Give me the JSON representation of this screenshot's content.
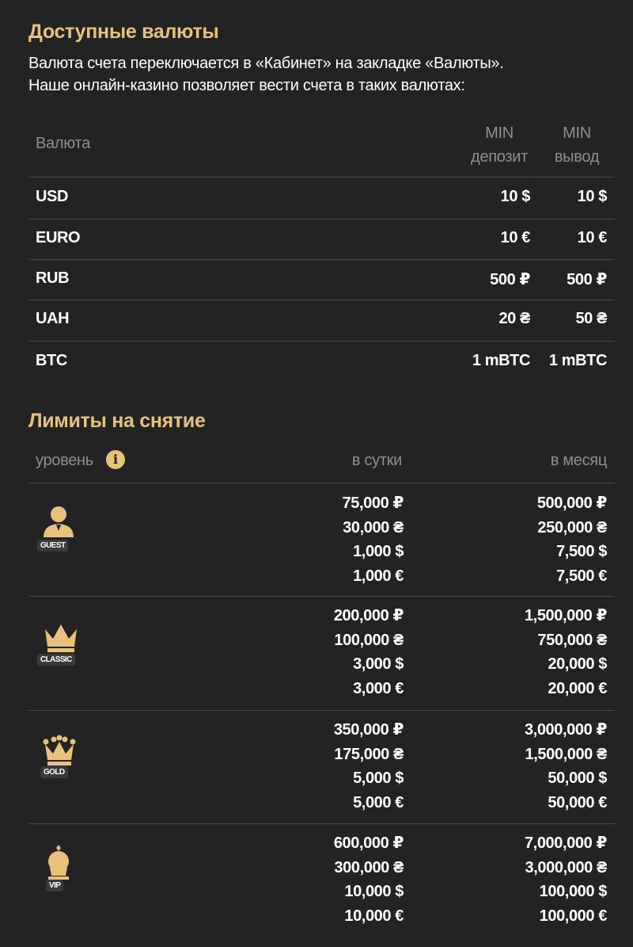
{
  "currencies_section": {
    "title": "Доступные валюты",
    "description_line1": "Валюта счета переключается в «Кабинет» на закладке «Валюты».",
    "description_line2": "Наше онлайн-казино позволяет вести счета в таких валютах:",
    "headers": {
      "currency": "Валюта",
      "min_deposit_1": "MIN",
      "min_deposit_2": "депозит",
      "min_withdraw_1": "MIN",
      "min_withdraw_2": "вывод"
    },
    "rows": [
      {
        "currency": "USD",
        "min_deposit": "10 $",
        "min_withdraw": "10 $"
      },
      {
        "currency": "EURO",
        "min_deposit": "10 €",
        "min_withdraw": "10 €"
      },
      {
        "currency": "RUB",
        "min_deposit": "500 ₽",
        "min_withdraw": "500 ₽"
      },
      {
        "currency": "UAH",
        "min_deposit": "20 ₴",
        "min_withdraw": "50 ₴"
      },
      {
        "currency": "BTC",
        "min_deposit": "1 mBTC",
        "min_withdraw": "1 mBTC"
      }
    ]
  },
  "limits_section": {
    "title": "Лимиты на снятие",
    "headers": {
      "level": "уровень",
      "per_day": "в сутки",
      "per_month": "в месяц"
    },
    "info_icon": "info-icon",
    "levels": [
      {
        "badge": "GUEST",
        "icon": "guest-icon",
        "per_day": [
          "75,000 ₽",
          "30,000 ₴",
          "1,000 $",
          "1,000 €"
        ],
        "per_month": [
          "500,000 ₽",
          "250,000 ₴",
          "7,500 $",
          "7,500 €"
        ]
      },
      {
        "badge": "CLASSIC",
        "icon": "crown-icon",
        "per_day": [
          "200,000 ₽",
          "100,000 ₴",
          "3,000 $",
          "3,000 €"
        ],
        "per_month": [
          "1,500,000 ₽",
          "750,000 ₴",
          "20,000 $",
          "20,000 €"
        ]
      },
      {
        "badge": "GOLD",
        "icon": "jeweled-crown-icon",
        "per_day": [
          "350,000 ₽",
          "175,000 ₴",
          "5,000 $",
          "5,000 €"
        ],
        "per_month": [
          "3,000,000 ₽",
          "1,500,000 ₴",
          "50,000 $",
          "50,000 €"
        ]
      },
      {
        "badge": "VIP",
        "icon": "king-icon",
        "per_day": [
          "600,000 ₽",
          "300,000 ₴",
          "10,000 $",
          "10,000 €"
        ],
        "per_month": [
          "7,000,000 ₽",
          "3,000,000 ₴",
          "100,000 $",
          "100,000 €"
        ]
      }
    ]
  },
  "colors": {
    "background": "#232323",
    "accent": "#e8c27a",
    "text": "#ffffff",
    "muted": "#8f8f8f",
    "divider": "#4a4a4a"
  }
}
